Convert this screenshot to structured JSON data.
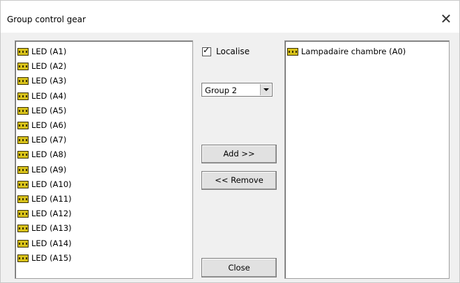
{
  "window": {
    "title": "Group control gear",
    "close_glyph": "✕"
  },
  "left_list": {
    "icon": "control-gear-icon",
    "items": [
      "LED (A1)",
      "LED (A2)",
      "LED (A3)",
      "LED (A4)",
      "LED (A5)",
      "LED (A6)",
      "LED (A7)",
      "LED (A8)",
      "LED (A9)",
      "LED (A10)",
      "LED (A11)",
      "LED (A12)",
      "LED (A13)",
      "LED (A14)",
      "LED (A15)"
    ]
  },
  "controls": {
    "localise_label": "Localise",
    "localise_checked": true,
    "group_select_value": "Group 2",
    "add_label": "Add >>",
    "remove_label": "<< Remove",
    "close_label": "Close"
  },
  "right_list": {
    "icon": "control-gear-icon",
    "items": [
      "Lampadaire chambre (A0)"
    ]
  },
  "colors": {
    "icon_fill": "#d8c21a",
    "icon_stroke": "#3a3000"
  }
}
